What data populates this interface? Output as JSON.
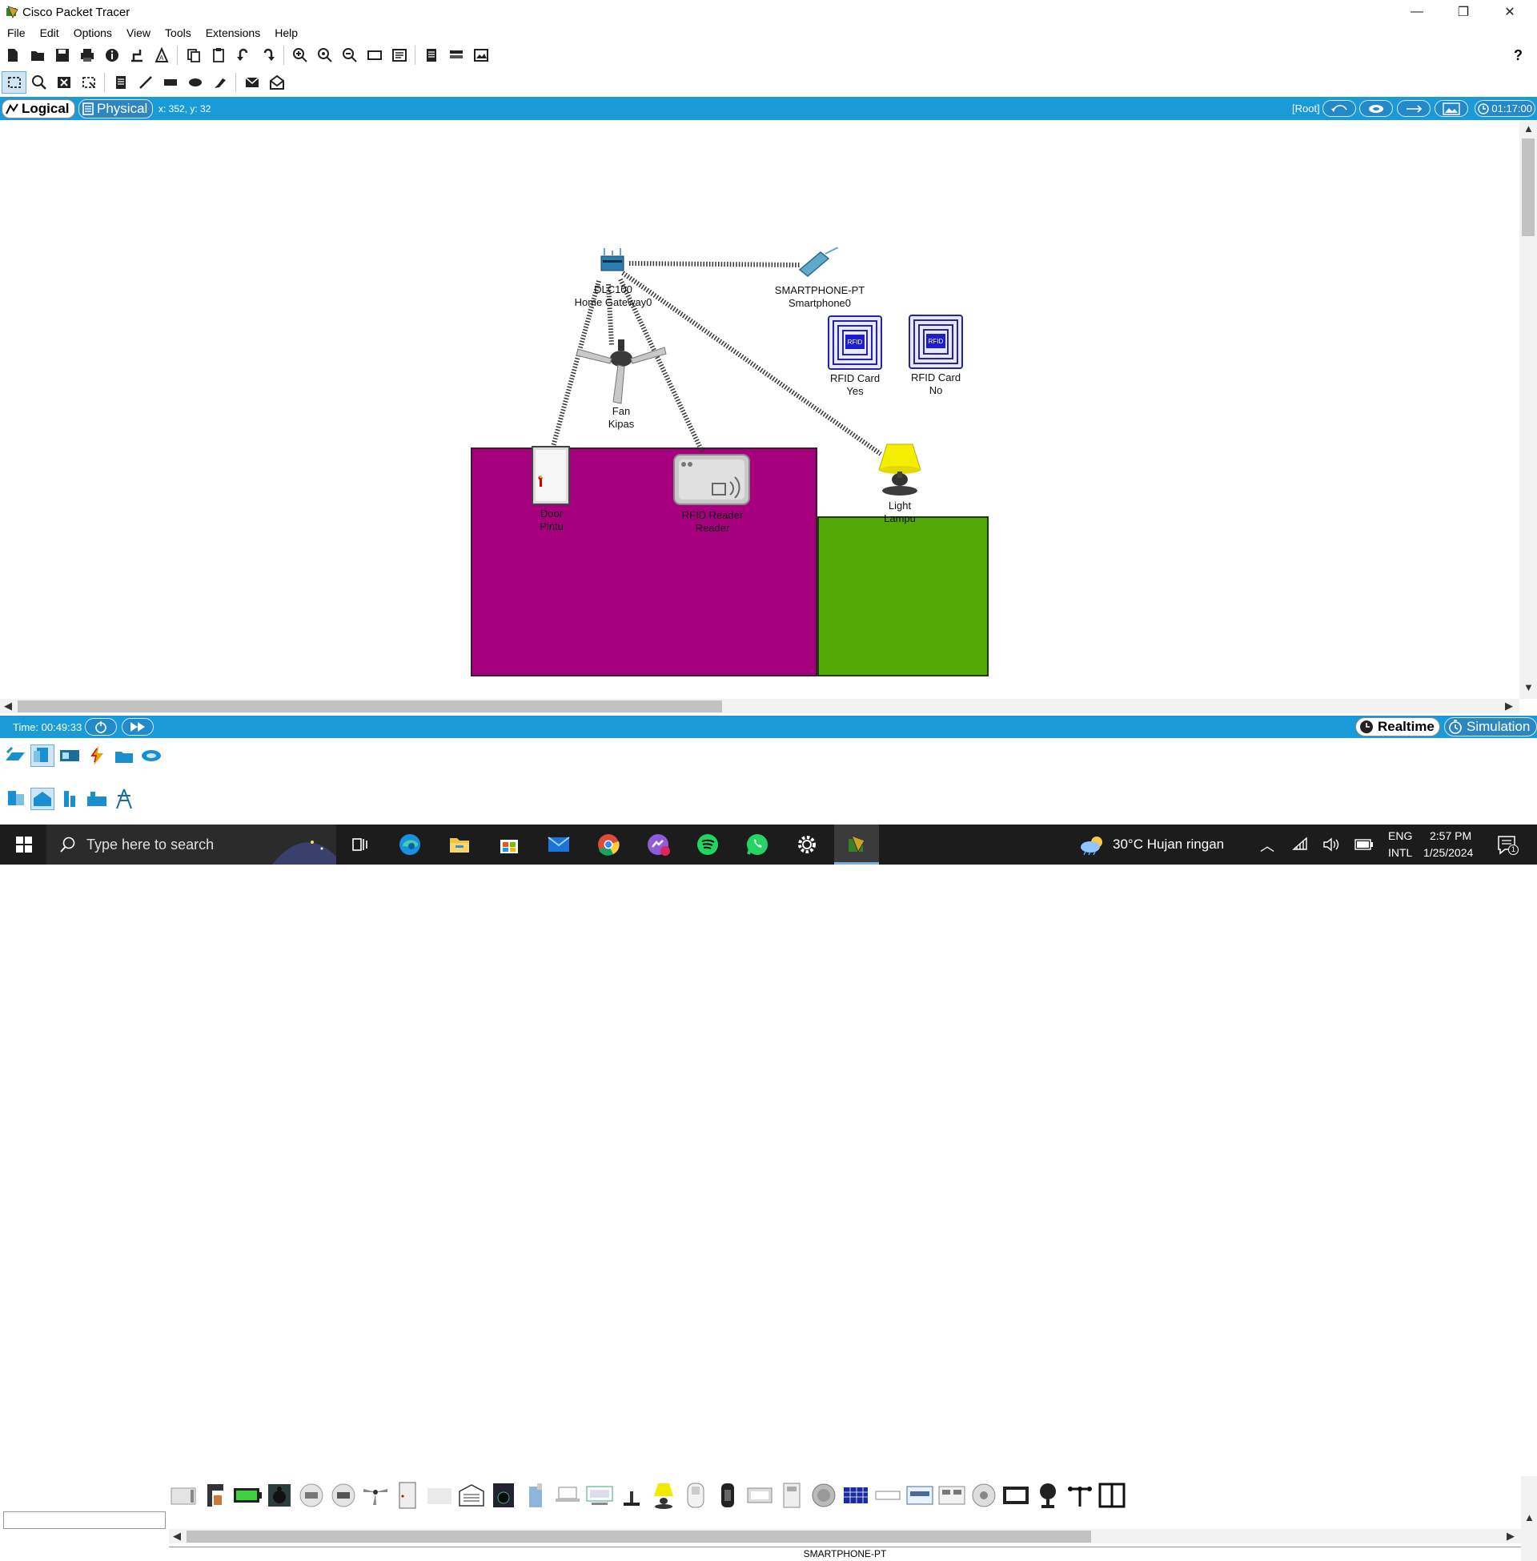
{
  "window": {
    "title": "Cisco Packet Tracer",
    "minimize_glyph": "—",
    "restore_glyph": "❐",
    "close_glyph": "✕"
  },
  "menu": [
    "File",
    "Edit",
    "Options",
    "View",
    "Tools",
    "Extensions",
    "Help"
  ],
  "toolbar": {
    "help_glyph": "?"
  },
  "viewbar": {
    "logical_label": "Logical",
    "physical_label": "Physical",
    "coords": "x: 352, y: 32",
    "root_label": "[Root]",
    "clock": "01:17:00"
  },
  "canvas": {
    "gateway": {
      "name": "DLC100",
      "label": "Home Gateway0"
    },
    "smartphone": {
      "name": "SMARTPHONE-PT",
      "label": "Smartphone0"
    },
    "rfid_yes": {
      "name": "RFID Card",
      "label": "Yes",
      "icon_text": "RFID"
    },
    "rfid_no": {
      "name": "RFID Card",
      "label": "No",
      "icon_text": "RFID"
    },
    "fan": {
      "name": "Fan",
      "label": "Kipas"
    },
    "door": {
      "name": "Door",
      "label": "Pintu"
    },
    "reader": {
      "name": "RFID Reader",
      "label": "Reader"
    },
    "light": {
      "name": "Light",
      "label": "Lampu"
    },
    "room_colors": {
      "purple": "#a6007e",
      "green": "#53a905"
    }
  },
  "timebar": {
    "time": "Time: 00:49:33",
    "realtime_label": "Realtime",
    "simulation_label": "Simulation"
  },
  "device_panel": {
    "selected_device": "SMARTPHONE-PT",
    "search_value": ""
  },
  "taskbar": {
    "search_placeholder": "Type here to search",
    "weather": "30°C  Hujan ringan",
    "lang_top": "ENG",
    "lang_bottom": "INTL",
    "time": "2:57 PM",
    "date": "1/25/2024",
    "notification_count": "1"
  },
  "colors": {
    "accent_blue": "#1a9bd7",
    "taskbar": "#1c1c1c"
  }
}
